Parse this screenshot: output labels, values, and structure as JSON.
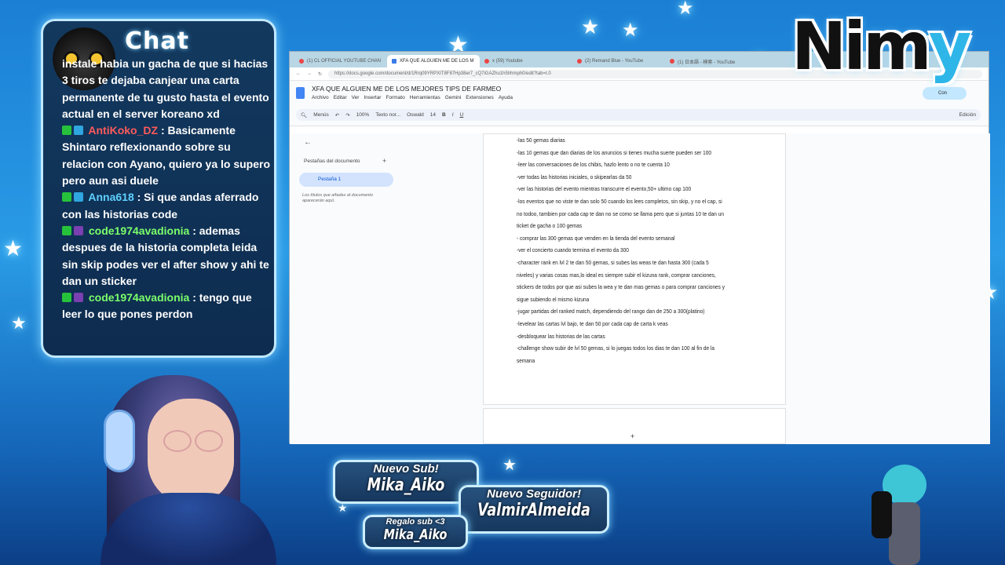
{
  "chat": {
    "title": "Chat",
    "cut_line": "instale habia un gacha de que si hacias 3 tiros te dejaba canjear una carta permanente de tu gusto hasta el evento actual en el server koreano xd",
    "messages": [
      {
        "user": "AntiKoko_DZ",
        "user_color": "#ff5a5a",
        "text": ": Basicamente Shintaro reflexionando sobre su relacion con Ayano, quiero ya lo supero pero aun asi duele"
      },
      {
        "user": "Anna618",
        "user_color": "#5fd0ff",
        "text": ": Si que andas aferrado con las historias code"
      },
      {
        "user": "code1974avadionia",
        "user_color": "#7bff6a",
        "text": ": ademas despues de la historia completa leida sin skip podes ver el after show y ahi te dan un sticker"
      },
      {
        "user": "code1974avadionia",
        "user_color": "#7bff6a",
        "text": ": tengo que leer lo que pones perdon"
      }
    ]
  },
  "browser": {
    "tabs": [
      {
        "label": "(1) CL OFFICIAL YOUTUBE CHAN"
      },
      {
        "label": "XFA QUE ALGUIEN ME DE LOS M"
      },
      {
        "label": "x (59) Youtube"
      },
      {
        "label": "(2) Remand Blue - YouTube"
      },
      {
        "label": "(1) 日本語 - 検索 - YouTube"
      }
    ],
    "url": "https://docs.google.com/document/d/1Rrq09YRPXIT8F87Hp38er7_cQ7iGAZhu1h5hhmph0/edit?tab=t.0"
  },
  "doc": {
    "title": "XFA QUE ALGUIEN ME DE LOS MEJORES TIPS DE FARMEO",
    "menus": [
      "Archivo",
      "Editar",
      "Ver",
      "Insertar",
      "Formato",
      "Herramientas",
      "Gemini",
      "Extensiones",
      "Ayuda"
    ],
    "toolbar": {
      "menus": "Menús",
      "zoom": "100%",
      "style": "Texto nor...",
      "font": "Oswald",
      "size": "14",
      "mode": "Edición"
    },
    "share": "Con",
    "sidebar": {
      "heading": "Pestañas del documento",
      "tab": "Pestaña 1",
      "note": "Los títulos que añadas al documento aparecerán aquí."
    },
    "lines": [
      "-las 50 gemas diarias",
      "-las 10 gemas que dan diarias de los anuncios si tienes mucha suerte pueden ser 100",
      "-leer las conversaciones de los chibis, hazlo lento o no te cuenta 10",
      "-ver todas las historias iniciales, o skipearlas da 50",
      "-ver las historias del evento mientras transcurre el evento,50+ ultimo cap 100",
      "-los eventos que no viste te dan solo 50 cuando los lees completos, sin skip, y no el cap, si",
      "no todoo, tambien por cada cap te dan no se como se llama pero que si juntas 10 te dan un",
      "ticket de gacha o 100 gemas",
      "- comprar las 300 gemas que venden en la tienda del evento semanal",
      "-ver el concierto cuando termina el evento da 300",
      "-character rank en lvl 2 te dan 50 gemas, si subes las weas te dan hasta 300 (cada 5",
      "niveles) y varias cosas mas,lo ideal es siempre subir el kizuna rank, comprar canciones,",
      "stickers de todos  por que asi subes la wea y te dan mas gemas o para comprar canciones y",
      "sigue subiendo el mismo kizuna",
      "-jugar partidas del ranked match, dependiendo del rango dan de 250 a 300(platino)",
      "-levelear las cartas lvl bajo, te dan 50 por cada cap de carta k veas",
      "-desbloquear las historias de las cartas",
      "-challenge show subir de lvl 50 gemas, si lo juegas todos los dias te dan 100 al fin de la",
      "semana"
    ]
  },
  "logo": {
    "text_main": "Nim",
    "text_end": "y"
  },
  "alerts": {
    "sub": {
      "title": "Nuevo Sub!",
      "name": "Mika_Aiko"
    },
    "follower": {
      "title": "Nuevo Seguidor!",
      "name": "ValmirAlmeida"
    },
    "gift": {
      "title": "Regalo sub <3",
      "name": "Mika_Aiko"
    }
  }
}
